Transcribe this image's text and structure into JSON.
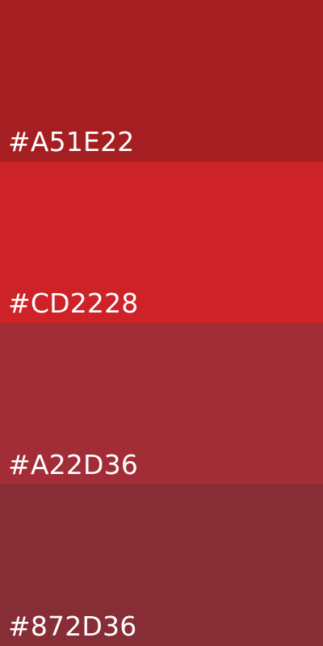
{
  "swatches": [
    {
      "label": "#A51E22",
      "color": "#A51E22"
    },
    {
      "label": "#CD2228",
      "color": "#CD2228"
    },
    {
      "label": "#A22D36",
      "color": "#A22D36"
    },
    {
      "label": "#872D36",
      "color": "#872D36"
    }
  ]
}
